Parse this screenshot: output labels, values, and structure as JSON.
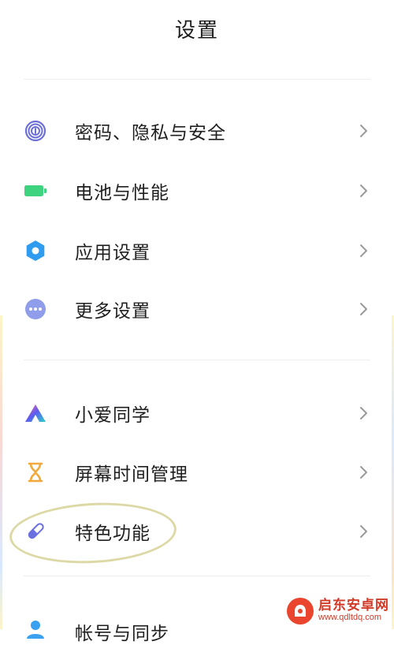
{
  "header": {
    "title": "设置"
  },
  "group1": [
    {
      "label": "密码、隐私与安全",
      "icon": "fingerprint-icon",
      "color": "#6c6fd6"
    },
    {
      "label": "电池与性能",
      "icon": "battery-icon",
      "color": "#3ed37f"
    },
    {
      "label": "应用设置",
      "icon": "gear-icon",
      "color": "#2f9cf0"
    },
    {
      "label": "更多设置",
      "icon": "more-dots-icon",
      "color": "#8f9dea"
    }
  ],
  "group2": [
    {
      "label": "小爱同学",
      "icon": "xiaoai-icon",
      "color": "#5a5df0"
    },
    {
      "label": "屏幕时间管理",
      "icon": "hourglass-icon",
      "color": "#f2a93b"
    },
    {
      "label": "特色功能",
      "icon": "test-tube-icon",
      "color": "#6b6fe0"
    }
  ],
  "partial_item": {
    "label": "帐号与同步",
    "icon": "account-icon",
    "color": "#3aa1f0"
  },
  "watermark": {
    "name": "启东安卓网",
    "url": "www.qdltdq.com"
  },
  "colors": {
    "chevron": "#9a9a9a",
    "divider": "#efefef",
    "highlight": "#ddd9a6"
  }
}
